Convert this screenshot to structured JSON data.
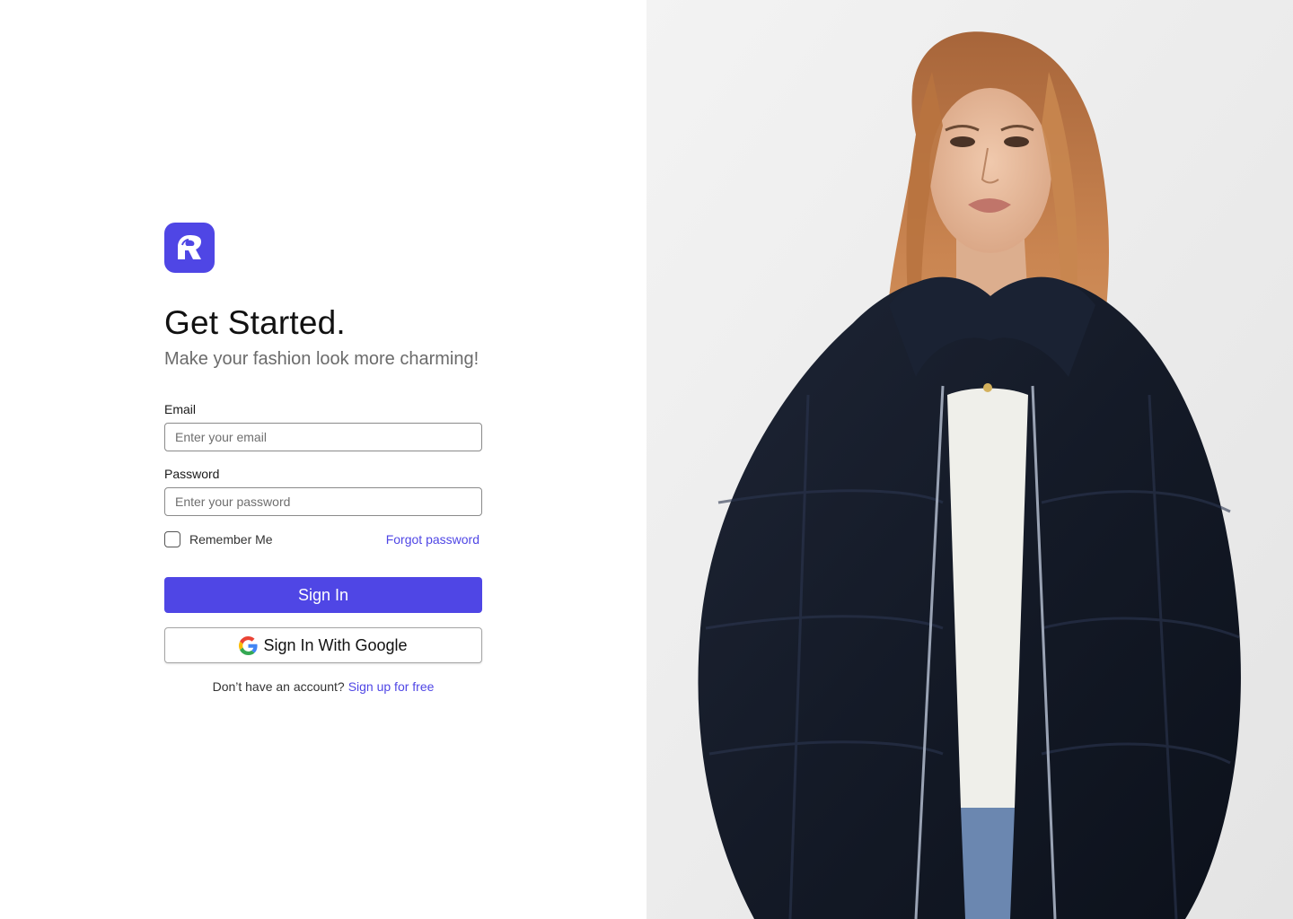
{
  "brand": {
    "logo_icon": "brand-logo-icon",
    "accent_color": "#4f46e5"
  },
  "heading": {
    "title": "Get Started.",
    "subtitle": "Make your fashion look more charming!"
  },
  "form": {
    "email_label": "Email",
    "email_placeholder": "Enter your email",
    "email_value": "",
    "password_label": "Password",
    "password_placeholder": "Enter your password",
    "password_value": "",
    "remember_label": "Remember Me",
    "remember_checked": false,
    "forgot_label": "Forgot password",
    "sign_in_label": "Sign In",
    "google_label": "Sign In With Google",
    "google_icon": "google-icon"
  },
  "footer": {
    "prompt": "Don’t have an account?",
    "signup_label": "Sign up for free"
  },
  "hero": {
    "image_icon": "fashion-model-photo",
    "background_color": "#ededed"
  }
}
